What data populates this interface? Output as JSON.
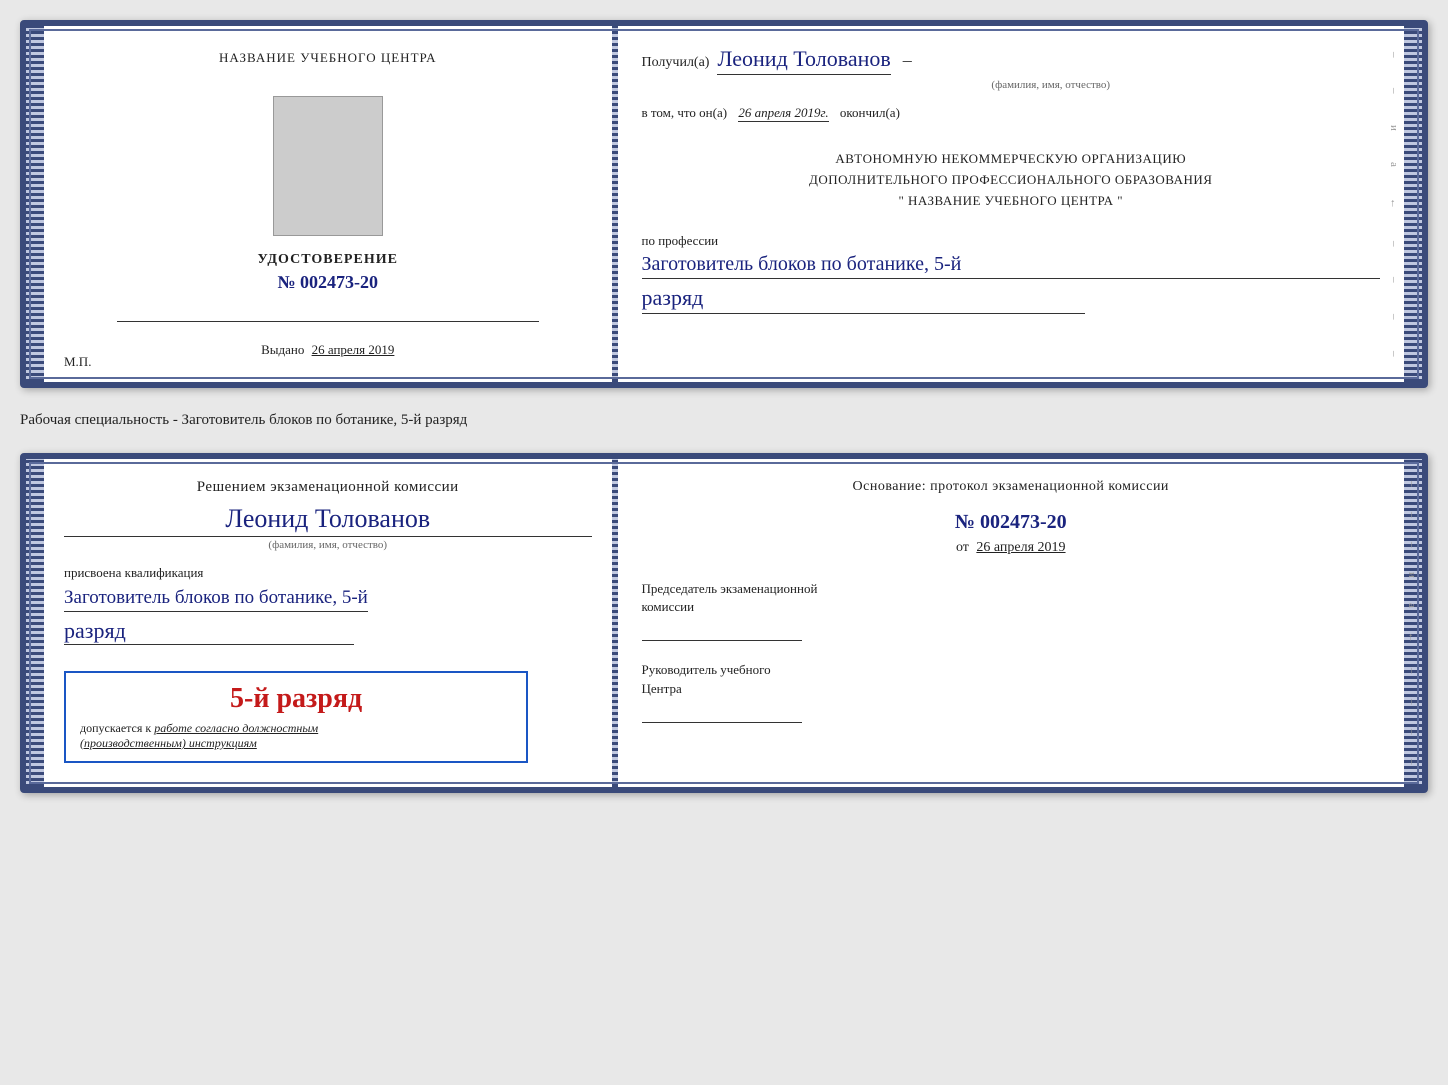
{
  "page": {
    "background": "#e8e8e8"
  },
  "cert1": {
    "left": {
      "title": "НАЗВАНИЕ УЧЕБНОГО ЦЕНТРА",
      "udost_label": "УДОСТОВЕРЕНИЕ",
      "number": "№ 002473-20",
      "vydano_label": "Выдано",
      "vydano_date": "26 апреля 2019",
      "mp_label": "М.П."
    },
    "right": {
      "poluchil": "Получил(а)",
      "name": "Леонид Толованов",
      "name_dash": "–",
      "fio_subtitle": "(фамилия, имя, отчество)",
      "v_tom_chto": "в том, что он(а)",
      "date_italic": "26 апреля 2019г.",
      "okonchill": "окончил(а)",
      "org_line1": "АВТОНОМНУЮ НЕКОММЕРЧЕСКУЮ ОРГАНИЗАЦИЮ",
      "org_line2": "ДОПОЛНИТЕЛЬНОГО ПРОФЕССИОНАЛЬНОГО ОБРАЗОВАНИЯ",
      "org_line3": "\"  НАЗВАНИЕ УЧЕБНОГО ЦЕНТРА   \"",
      "po_professii": "по профессии",
      "profession": "Заготовитель блоков по ботанике, 5-й",
      "razryad": "разряд"
    }
  },
  "specialty_label": "Рабочая специальность - Заготовитель блоков по ботанике, 5-й разряд",
  "cert2": {
    "left": {
      "decision_text": "Решением экзаменационной комиссии",
      "person_name": "Леонид Толованов",
      "fio_sub": "(фамилия, имя, отчество)",
      "assigned": "присвоена квалификация",
      "qual_name": "Заготовитель блоков по ботанике, 5-й",
      "razryad": "разряд",
      "stamp_razryad": "5-й разряд",
      "допускается": "допускается к",
      "rabota": "работе согласно должностным",
      "instruktsii": "(производственным) инструкциям"
    },
    "right": {
      "osnov_text": "Основание: протокол экзаменационной комиссии",
      "protocol_num": "№ 002473-20",
      "ot_label": "от",
      "ot_date": "26 апреля 2019",
      "predsedatel_title": "Председатель экзаменационной",
      "predsedatel_komissii": "комиссии",
      "rukovoditel_title": "Руководитель учебного",
      "tsentra": "Центра"
    }
  }
}
